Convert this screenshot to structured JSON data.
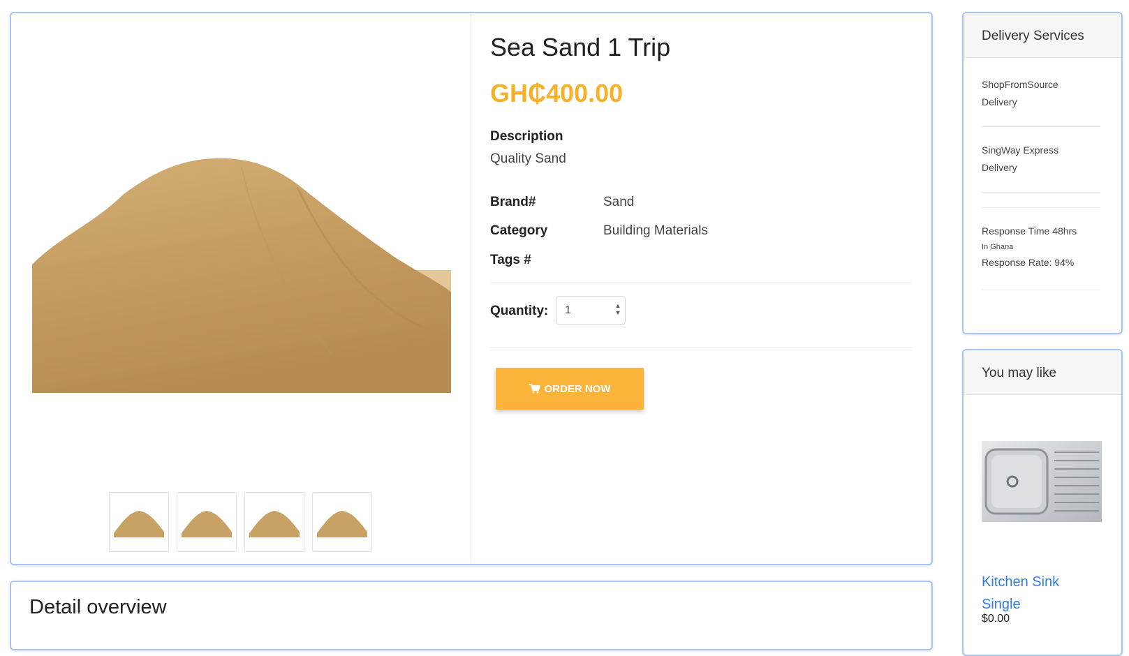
{
  "product": {
    "title": "Sea Sand 1 Trip",
    "price": "GH₵400.00",
    "description_label": "Description",
    "description_value": "Quality Sand",
    "specs": [
      {
        "label": "Brand#",
        "value": "Sand"
      },
      {
        "label": "Category",
        "value": "Building Materials"
      },
      {
        "label": "Tags #",
        "value": ""
      }
    ],
    "quantity_label": "Quantity:",
    "quantity_value": "1",
    "order_button": "ORDER NOW",
    "accent_color": "#fbb33a"
  },
  "detail": {
    "title": "Detail overview"
  },
  "delivery": {
    "title": "Delivery Services",
    "items": [
      {
        "line1": "ShopFromSource",
        "line2": "Delivery"
      },
      {
        "line1": "SingWay Express",
        "line2": "Delivery"
      }
    ],
    "response_time": "Response Time 48hrs",
    "response_region": "In Ghana",
    "response_rate": "Response Rate: 94%"
  },
  "recommend": {
    "title": "You may like",
    "item_name_line1": "Kitchen Sink",
    "item_name_line2": "Single",
    "item_price": "$0.00"
  }
}
